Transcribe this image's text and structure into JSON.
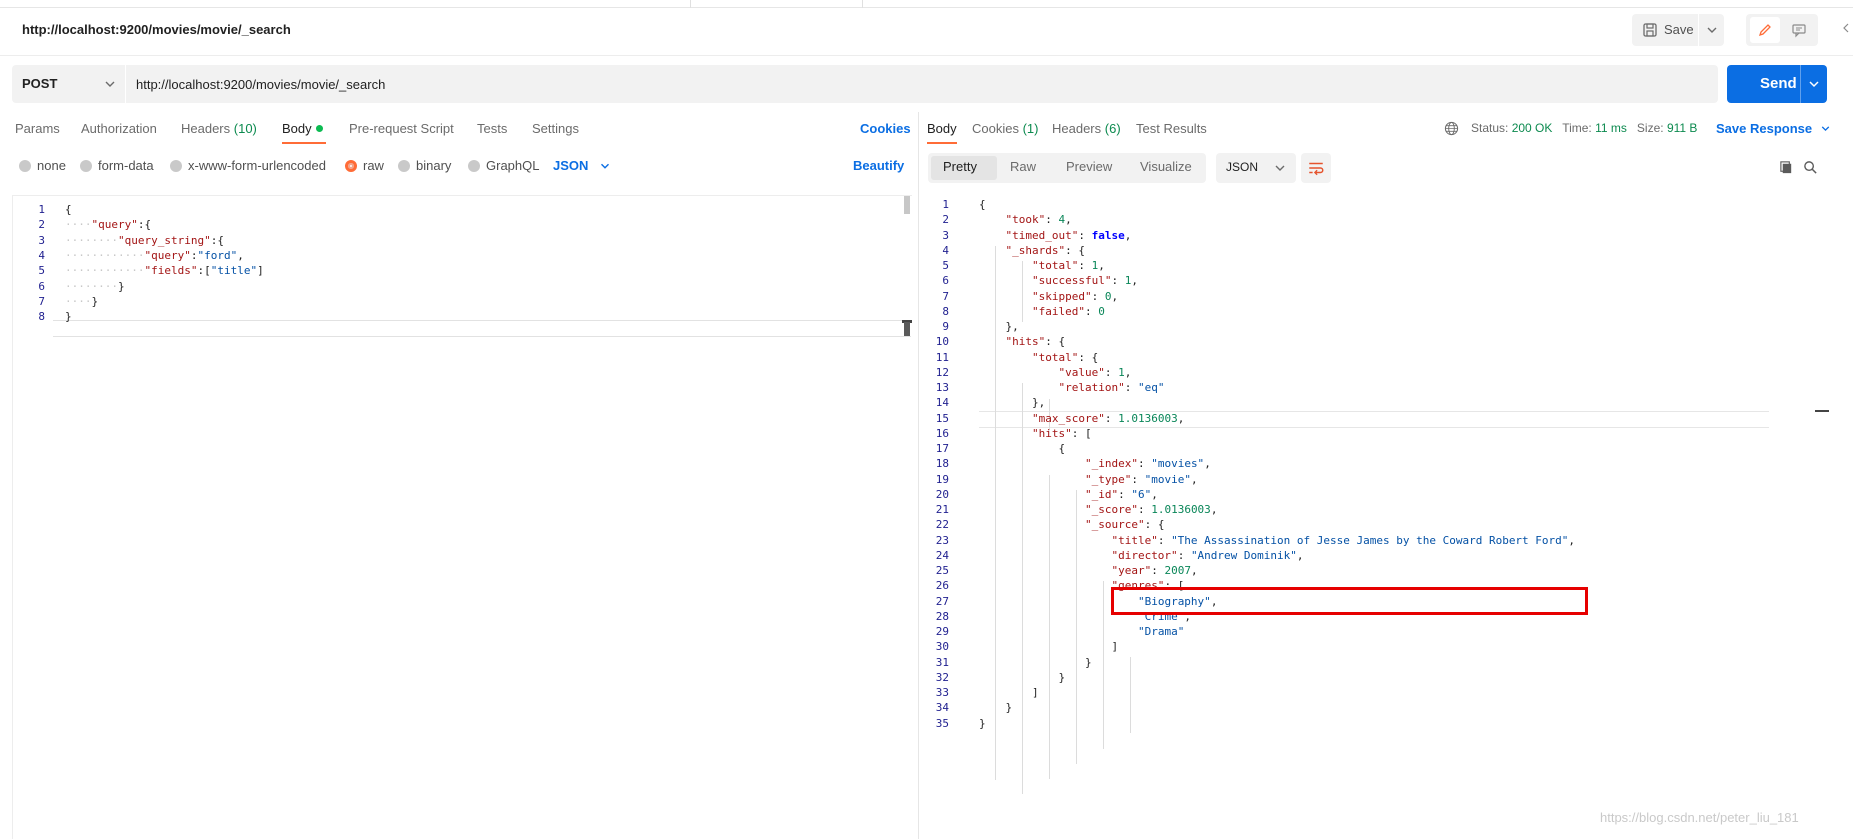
{
  "request": {
    "title": "http://localhost:9200/movies/movie/_search",
    "save_label": "Save",
    "method": "POST",
    "url": "http://localhost:9200/movies/movie/_search",
    "send_label": "Send"
  },
  "request_tabs": {
    "params": "Params",
    "authorization": "Authorization",
    "headers": "Headers",
    "headers_count": "(10)",
    "body": "Body",
    "prerequest": "Pre-request Script",
    "tests": "Tests",
    "settings": "Settings",
    "cookies": "Cookies"
  },
  "body_modes": {
    "none": "none",
    "form_data": "form-data",
    "urlencoded": "x-www-form-urlencoded",
    "raw": "raw",
    "binary": "binary",
    "graphql": "GraphQL",
    "language": "JSON",
    "beautify": "Beautify",
    "selected": "raw"
  },
  "request_body": {
    "line_numbers": [
      "1",
      "2",
      "3",
      "4",
      "5",
      "6",
      "7",
      "8"
    ],
    "lines": [
      [
        {
          "t": "{",
          "c": "p"
        }
      ],
      [
        {
          "t": "····",
          "c": "dots"
        },
        {
          "t": "\"query\"",
          "c": "k"
        },
        {
          "t": ":{",
          "c": "p"
        }
      ],
      [
        {
          "t": "········",
          "c": "dots"
        },
        {
          "t": "\"query_string\"",
          "c": "k"
        },
        {
          "t": ":{",
          "c": "p"
        }
      ],
      [
        {
          "t": "············",
          "c": "dots"
        },
        {
          "t": "\"query\"",
          "c": "k"
        },
        {
          "t": ":",
          "c": "p"
        },
        {
          "t": "\"ford\"",
          "c": "s"
        },
        {
          "t": ",",
          "c": "p"
        }
      ],
      [
        {
          "t": "············",
          "c": "dots"
        },
        {
          "t": "\"fields\"",
          "c": "k"
        },
        {
          "t": ":[",
          "c": "p"
        },
        {
          "t": "\"title\"",
          "c": "s"
        },
        {
          "t": "]",
          "c": "p"
        }
      ],
      [
        {
          "t": "········",
          "c": "dots"
        },
        {
          "t": "}",
          "c": "p"
        }
      ],
      [
        {
          "t": "····",
          "c": "dots"
        },
        {
          "t": "}",
          "c": "p"
        }
      ],
      [
        {
          "t": "}",
          "c": "p"
        }
      ]
    ]
  },
  "response_tabs": {
    "body": "Body",
    "cookies": "Cookies",
    "cookies_count": "(1)",
    "headers": "Headers",
    "headers_count": "(6)",
    "test_results": "Test Results"
  },
  "response_status": {
    "status_label": "Status:",
    "status_value": "200 OK",
    "time_label": "Time:",
    "time_value": "11 ms",
    "size_label": "Size:",
    "size_value": "911 B",
    "save_response": "Save Response"
  },
  "response_view": {
    "pretty": "Pretty",
    "raw": "Raw",
    "preview": "Preview",
    "visualize": "Visualize",
    "format": "JSON"
  },
  "response_body": {
    "lines": [
      [
        {
          "t": "{",
          "c": "p"
        }
      ],
      [
        {
          "t": "    ",
          "c": "p"
        },
        {
          "t": "\"took\"",
          "c": "k"
        },
        {
          "t": ": ",
          "c": "p"
        },
        {
          "t": "4",
          "c": "n"
        },
        {
          "t": ",",
          "c": "p"
        }
      ],
      [
        {
          "t": "    ",
          "c": "p"
        },
        {
          "t": "\"timed_out\"",
          "c": "k"
        },
        {
          "t": ": ",
          "c": "p"
        },
        {
          "t": "false",
          "c": "b"
        },
        {
          "t": ",",
          "c": "p"
        }
      ],
      [
        {
          "t": "    ",
          "c": "p"
        },
        {
          "t": "\"_shards\"",
          "c": "k"
        },
        {
          "t": ": {",
          "c": "p"
        }
      ],
      [
        {
          "t": "        ",
          "c": "p"
        },
        {
          "t": "\"total\"",
          "c": "k"
        },
        {
          "t": ": ",
          "c": "p"
        },
        {
          "t": "1",
          "c": "n"
        },
        {
          "t": ",",
          "c": "p"
        }
      ],
      [
        {
          "t": "        ",
          "c": "p"
        },
        {
          "t": "\"successful\"",
          "c": "k"
        },
        {
          "t": ": ",
          "c": "p"
        },
        {
          "t": "1",
          "c": "n"
        },
        {
          "t": ",",
          "c": "p"
        }
      ],
      [
        {
          "t": "        ",
          "c": "p"
        },
        {
          "t": "\"skipped\"",
          "c": "k"
        },
        {
          "t": ": ",
          "c": "p"
        },
        {
          "t": "0",
          "c": "n"
        },
        {
          "t": ",",
          "c": "p"
        }
      ],
      [
        {
          "t": "        ",
          "c": "p"
        },
        {
          "t": "\"failed\"",
          "c": "k"
        },
        {
          "t": ": ",
          "c": "p"
        },
        {
          "t": "0",
          "c": "n"
        }
      ],
      [
        {
          "t": "    },",
          "c": "p"
        }
      ],
      [
        {
          "t": "    ",
          "c": "p"
        },
        {
          "t": "\"hits\"",
          "c": "k"
        },
        {
          "t": ": {",
          "c": "p"
        }
      ],
      [
        {
          "t": "        ",
          "c": "p"
        },
        {
          "t": "\"total\"",
          "c": "k"
        },
        {
          "t": ": {",
          "c": "p"
        }
      ],
      [
        {
          "t": "            ",
          "c": "p"
        },
        {
          "t": "\"value\"",
          "c": "k"
        },
        {
          "t": ": ",
          "c": "p"
        },
        {
          "t": "1",
          "c": "n"
        },
        {
          "t": ",",
          "c": "p"
        }
      ],
      [
        {
          "t": "            ",
          "c": "p"
        },
        {
          "t": "\"relation\"",
          "c": "k"
        },
        {
          "t": ": ",
          "c": "p"
        },
        {
          "t": "\"eq\"",
          "c": "s"
        }
      ],
      [
        {
          "t": "        },",
          "c": "p"
        }
      ],
      [
        {
          "t": "        ",
          "c": "p"
        },
        {
          "t": "\"max_score\"",
          "c": "k"
        },
        {
          "t": ": ",
          "c": "p"
        },
        {
          "t": "1.0136003",
          "c": "n"
        },
        {
          "t": ",",
          "c": "p"
        }
      ],
      [
        {
          "t": "        ",
          "c": "p"
        },
        {
          "t": "\"hits\"",
          "c": "k"
        },
        {
          "t": ": [",
          "c": "p"
        }
      ],
      [
        {
          "t": "            {",
          "c": "p"
        }
      ],
      [
        {
          "t": "                ",
          "c": "p"
        },
        {
          "t": "\"_index\"",
          "c": "k"
        },
        {
          "t": ": ",
          "c": "p"
        },
        {
          "t": "\"movies\"",
          "c": "s"
        },
        {
          "t": ",",
          "c": "p"
        }
      ],
      [
        {
          "t": "                ",
          "c": "p"
        },
        {
          "t": "\"_type\"",
          "c": "k"
        },
        {
          "t": ": ",
          "c": "p"
        },
        {
          "t": "\"movie\"",
          "c": "s"
        },
        {
          "t": ",",
          "c": "p"
        }
      ],
      [
        {
          "t": "                ",
          "c": "p"
        },
        {
          "t": "\"_id\"",
          "c": "k"
        },
        {
          "t": ": ",
          "c": "p"
        },
        {
          "t": "\"6\"",
          "c": "s"
        },
        {
          "t": ",",
          "c": "p"
        }
      ],
      [
        {
          "t": "                ",
          "c": "p"
        },
        {
          "t": "\"_score\"",
          "c": "k"
        },
        {
          "t": ": ",
          "c": "p"
        },
        {
          "t": "1.0136003",
          "c": "n"
        },
        {
          "t": ",",
          "c": "p"
        }
      ],
      [
        {
          "t": "                ",
          "c": "p"
        },
        {
          "t": "\"_source\"",
          "c": "k"
        },
        {
          "t": ": {",
          "c": "p"
        }
      ],
      [
        {
          "t": "                    ",
          "c": "p"
        },
        {
          "t": "\"title\"",
          "c": "k"
        },
        {
          "t": ": ",
          "c": "p"
        },
        {
          "t": "\"The Assassination of Jesse James by the Coward Robert Ford\"",
          "c": "s"
        },
        {
          "t": ",",
          "c": "p"
        }
      ],
      [
        {
          "t": "                    ",
          "c": "p"
        },
        {
          "t": "\"director\"",
          "c": "k"
        },
        {
          "t": ": ",
          "c": "p"
        },
        {
          "t": "\"Andrew Dominik\"",
          "c": "s"
        },
        {
          "t": ",",
          "c": "p"
        }
      ],
      [
        {
          "t": "                    ",
          "c": "p"
        },
        {
          "t": "\"year\"",
          "c": "k"
        },
        {
          "t": ": ",
          "c": "p"
        },
        {
          "t": "2007",
          "c": "n"
        },
        {
          "t": ",",
          "c": "p"
        }
      ],
      [
        {
          "t": "                    ",
          "c": "p"
        },
        {
          "t": "\"genres\"",
          "c": "k"
        },
        {
          "t": ": [",
          "c": "p"
        }
      ],
      [
        {
          "t": "                        ",
          "c": "p"
        },
        {
          "t": "\"Biography\"",
          "c": "s"
        },
        {
          "t": ",",
          "c": "p"
        }
      ],
      [
        {
          "t": "                        ",
          "c": "p"
        },
        {
          "t": "\"Crime\"",
          "c": "s"
        },
        {
          "t": ",",
          "c": "p"
        }
      ],
      [
        {
          "t": "                        ",
          "c": "p"
        },
        {
          "t": "\"Drama\"",
          "c": "s"
        }
      ],
      [
        {
          "t": "                    ]",
          "c": "p"
        }
      ],
      [
        {
          "t": "                }",
          "c": "p"
        }
      ],
      [
        {
          "t": "            }",
          "c": "p"
        }
      ],
      [
        {
          "t": "        ]",
          "c": "p"
        }
      ],
      [
        {
          "t": "    }",
          "c": "p"
        }
      ],
      [
        {
          "t": "}",
          "c": "p"
        }
      ]
    ]
  },
  "watermark": "https://blog.csdn.net/peter_liu_181",
  "icons": {
    "save": "save-icon",
    "edit": "pencil-icon",
    "comment": "comment-icon",
    "globe": "globe-icon",
    "copy": "copy-icon",
    "search": "search-icon",
    "wrap": "wrap-lines-icon"
  },
  "colors": {
    "accent": "#ff6c37",
    "primary": "#0b6ee3",
    "success": "#0c8a4f",
    "highlight": "#e60000"
  }
}
